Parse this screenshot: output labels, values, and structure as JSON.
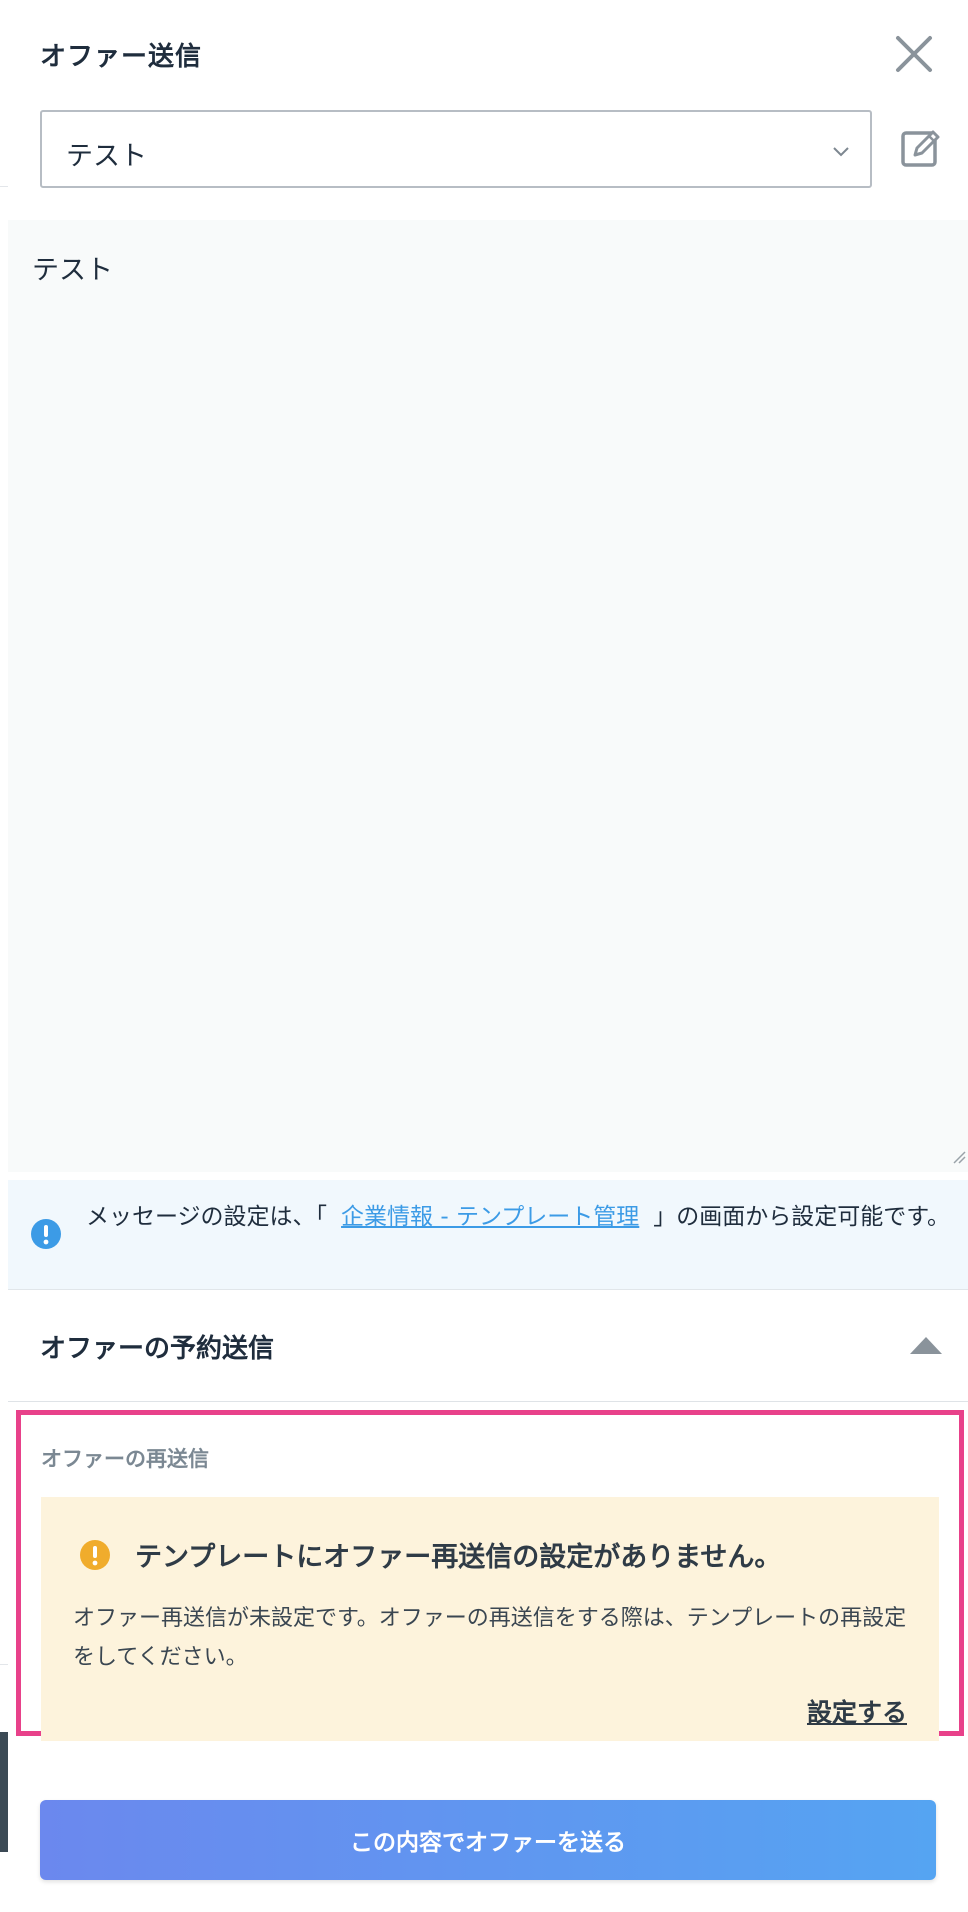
{
  "header": {
    "title": "オファー送信"
  },
  "template_select": {
    "selected": "テスト"
  },
  "message": {
    "body": "テスト"
  },
  "info_notice": {
    "text_before": "メッセージの設定は、「",
    "link_text": "企業情報 - テンプレート管理",
    "text_after": "」の画面から設定可能です。"
  },
  "scheduled_offer": {
    "title": "オファーの予約送信"
  },
  "resend": {
    "label": "オファーの再送信",
    "warning_title": "テンプレートにオファー再送信の設定がありません。",
    "warning_desc": "オファー再送信が未設定です。オファーの再送信をする際は、テンプレートの再設定をしてください。",
    "settings_link": "設定する"
  },
  "submit": {
    "label": "この内容でオファーを送る"
  },
  "colors": {
    "highlight": "#e8418a",
    "link": "#3c9be6",
    "info_icon": "#3c9be6",
    "warning_icon": "#f0ac2c",
    "warning_bg": "#fdf3dc",
    "button_start": "#6b88ee",
    "button_end": "#55a4f2"
  },
  "icons": {
    "close": "close-icon",
    "chevron": "chevron-down-icon",
    "edit": "edit-icon",
    "info": "info-icon",
    "caret": "caret-up-icon",
    "warning": "warning-icon",
    "resize": "resize-grip-icon"
  }
}
